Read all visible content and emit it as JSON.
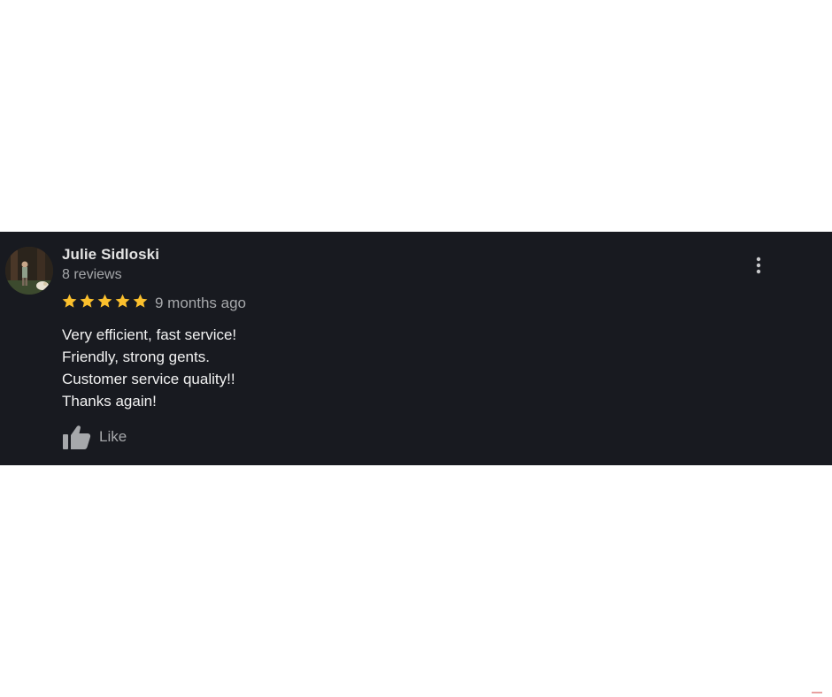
{
  "review": {
    "reviewer_name": "Julie Sidloski",
    "review_count": "8 reviews",
    "rating": 5,
    "rating_max": 5,
    "time_ago": "9 months ago",
    "text_lines": [
      "Very efficient, fast service!",
      "Friendly, strong gents.",
      "Customer service quality!!",
      "Thanks again!"
    ],
    "like_label": "Like"
  },
  "icons": {
    "avatar": "reviewer-avatar",
    "star": "star-icon",
    "more": "more-vertical-icon",
    "like": "thumbs-up-icon"
  },
  "colors": {
    "card_background": "#181a20",
    "page_background": "#ffffff",
    "star_color": "#fbc02d",
    "primary_text": "#f2f2f2",
    "secondary_text": "#a6a8ab"
  }
}
